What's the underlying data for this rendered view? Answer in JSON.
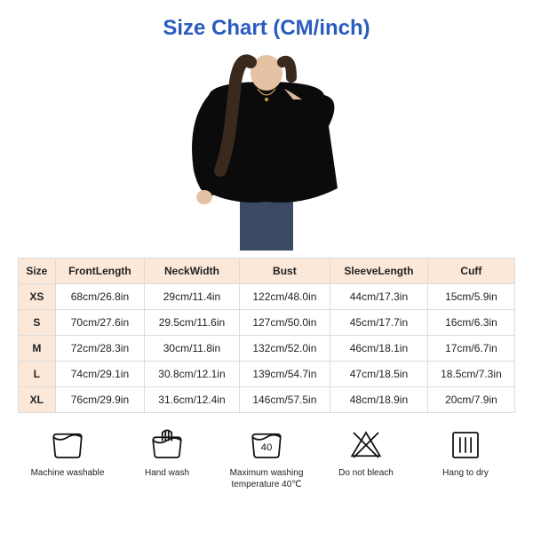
{
  "title": "Size Chart (CM/inch)",
  "chart_data": {
    "type": "table",
    "columns": [
      "Size",
      "FrontLength",
      "NeckWidth",
      "Bust",
      "SleeveLength",
      "Cuff"
    ],
    "rows": [
      {
        "size": "XS",
        "frontLength": "68cm/26.8in",
        "neckWidth": "29cm/11.4in",
        "bust": "122cm/48.0in",
        "sleeveLength": "44cm/17.3in",
        "cuff": "15cm/5.9in"
      },
      {
        "size": "S",
        "frontLength": "70cm/27.6in",
        "neckWidth": "29.5cm/11.6in",
        "bust": "127cm/50.0in",
        "sleeveLength": "45cm/17.7in",
        "cuff": "16cm/6.3in"
      },
      {
        "size": "M",
        "frontLength": "72cm/28.3in",
        "neckWidth": "30cm/11.8in",
        "bust": "132cm/52.0in",
        "sleeveLength": "46cm/18.1in",
        "cuff": "17cm/6.7in"
      },
      {
        "size": "L",
        "frontLength": "74cm/29.1in",
        "neckWidth": "30.8cm/12.1in",
        "bust": "139cm/54.7in",
        "sleeveLength": "47cm/18.5in",
        "cuff": "18.5cm/7.3in"
      },
      {
        "size": "XL",
        "frontLength": "76cm/29.9in",
        "neckWidth": "31.6cm/12.4in",
        "bust": "146cm/57.5in",
        "sleeveLength": "48cm/18.9in",
        "cuff": "20cm/7.9in"
      }
    ]
  },
  "care": [
    {
      "icon": "machine-wash-icon",
      "label": "Machine washable"
    },
    {
      "icon": "hand-wash-icon",
      "label": "Hand wash"
    },
    {
      "icon": "wash-40-icon",
      "label": "Maximum washing temperature 40℃",
      "temp": "40"
    },
    {
      "icon": "no-bleach-icon",
      "label": "Do not bleach"
    },
    {
      "icon": "hang-dry-icon",
      "label": "Hang to dry"
    }
  ]
}
